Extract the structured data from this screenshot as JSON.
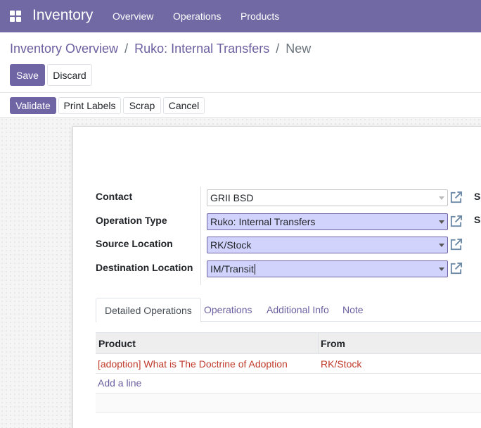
{
  "navbar": {
    "app_title": "Inventory",
    "menu": [
      "Overview",
      "Operations",
      "Products"
    ]
  },
  "breadcrumb": {
    "items": [
      "Inventory Overview",
      "Ruko: Internal Transfers"
    ],
    "separator": "/",
    "current": "New"
  },
  "form_buttons": {
    "save": "Save",
    "discard": "Discard"
  },
  "status_buttons": {
    "validate": "Validate",
    "print_labels": "Print Labels",
    "scrap": "Scrap",
    "cancel": "Cancel"
  },
  "fields": {
    "contact": {
      "label": "Contact",
      "value": "GRII BSD"
    },
    "operation_type": {
      "label": "Operation Type",
      "value": "Ruko: Internal Transfers"
    },
    "source_location": {
      "label": "Source Location",
      "value": "RK/Stock"
    },
    "destination_location": {
      "label": "Destination Location",
      "value": "IM/Transit"
    }
  },
  "side_labels": [
    "Sc",
    "Sc"
  ],
  "tabs": [
    "Detailed Operations",
    "Operations",
    "Additional Info",
    "Note"
  ],
  "table": {
    "columns": [
      "Product",
      "From"
    ],
    "rows": [
      {
        "product": "[adoption] What is The Doctrine of Adoption",
        "from": "RK/Stock"
      }
    ],
    "add_line": "Add a line"
  },
  "colors": {
    "brand": "#7069a3",
    "primary_button": "#6f65a5",
    "required_field": "#d2d3fd",
    "link": "#6c5fa0",
    "product_text": "#c0392b"
  },
  "icons": {
    "apps": "apps-grid-icon",
    "external": "external-link-icon",
    "caret": "caret-down-icon"
  }
}
